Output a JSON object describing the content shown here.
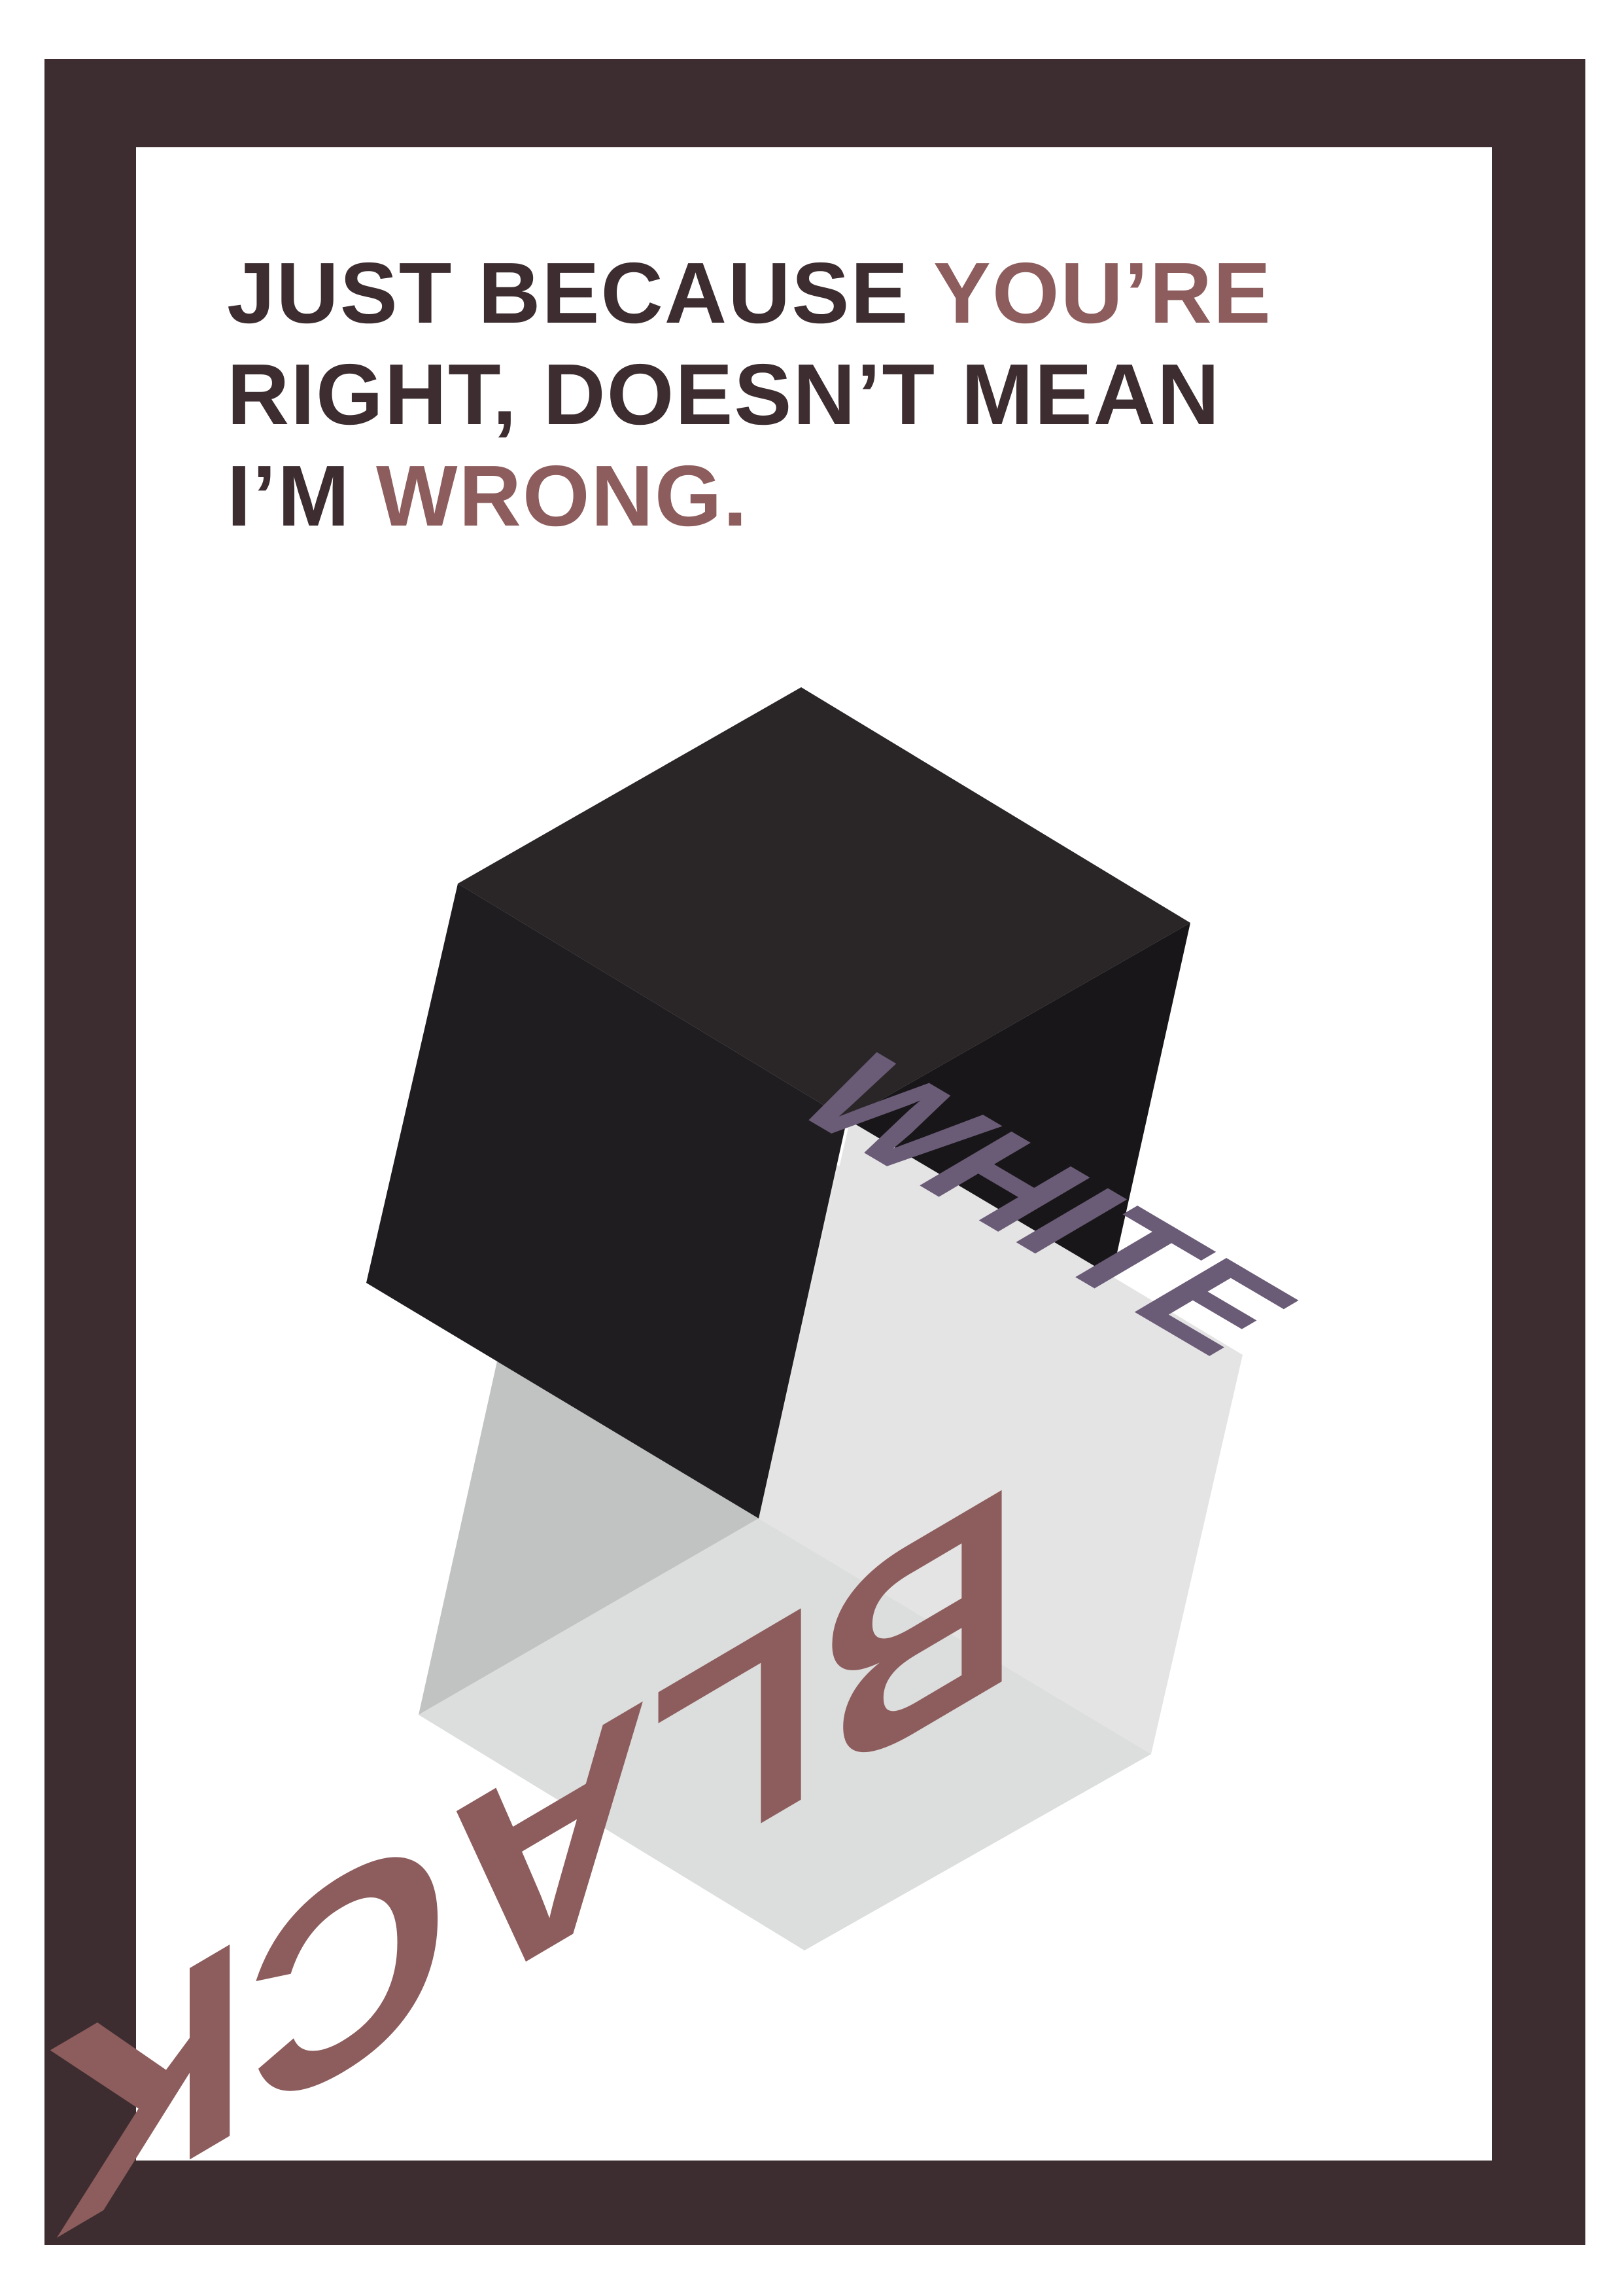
{
  "colors": {
    "frame": "#3d2d30",
    "dark_text": "#3d2d30",
    "accent": "#8d5c5c",
    "white_cube_lettering": "#6a5b77",
    "black_cube_lettering": "#8d5c5c"
  },
  "headline": {
    "line1": {
      "text": "JUST BECAUSE ",
      "accent": "YOU’RE"
    },
    "line2": {
      "text": "RIGHT, DOESN’T MEAN"
    },
    "line3": {
      "text": "I’M ",
      "accent": "WRONG."
    }
  },
  "cube_dark": {
    "word": "WHITE"
  },
  "cube_light": {
    "word": "BLACK"
  }
}
